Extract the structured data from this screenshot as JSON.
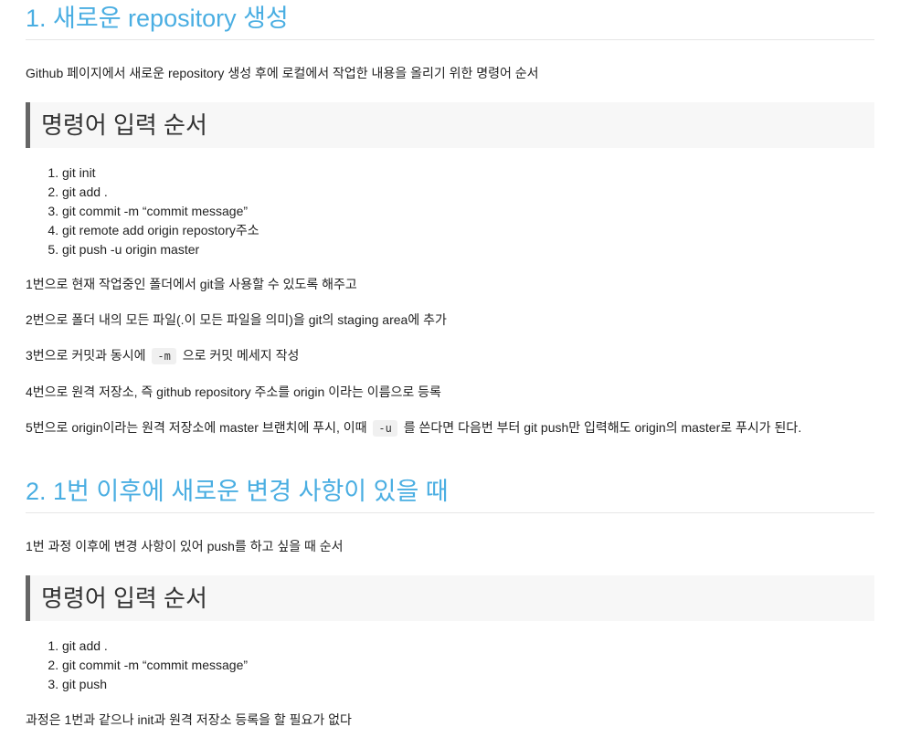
{
  "section1": {
    "title": "1. 새로운 repository 생성",
    "intro": "Github 페이지에서 새로운 repository 생성 후에 로컬에서 작업한 내용을 올리기 위한 명령어 순서",
    "subheading": "명령어 입력 순서",
    "steps": [
      "git init",
      "git add .",
      "git commit -m “commit message”",
      "git remote add origin repostory주소",
      "git push -u origin master"
    ],
    "explanations": {
      "e1": "1번으로 현재 작업중인 폴더에서 git을 사용할 수 있도록 해주고",
      "e2": "2번으로 폴더 내의 모든 파일(.이 모든 파일을 의미)을 git의 staging area에 추가",
      "e3_before": "3번으로 커밋과 동시에",
      "e3_code": "-m",
      "e3_after": "으로 커밋 메세지 작성",
      "e4": "4번으로 원격 저장소, 즉 github repository 주소를 origin 이라는 이름으로 등록",
      "e5_before": "5번으로 origin이라는 원격 저장소에 master 브랜치에 푸시, 이때",
      "e5_code": "-u",
      "e5_after": "를 쓴다면 다음번 부터 git push만 입력해도 origin의 master로 푸시가 된다."
    }
  },
  "section2": {
    "title": "2. 1번 이후에 새로운 변경 사항이 있을 때",
    "intro": "1번 과정 이후에 변경 사항이 있어 push를 하고 싶을 때 순서",
    "subheading": "명령어 입력 순서",
    "steps": [
      "git add .",
      "git commit -m “commit message”",
      "git push"
    ],
    "outro": "과정은 1번과 같으나 init과 원격 저장소 등록을 할 필요가 없다"
  },
  "colors": {
    "heading": "#4aaee2",
    "subheading_border": "#666666",
    "subheading_bg": "#f7f7f7",
    "text": "#222222",
    "code_bg": "#f0f0f0"
  }
}
